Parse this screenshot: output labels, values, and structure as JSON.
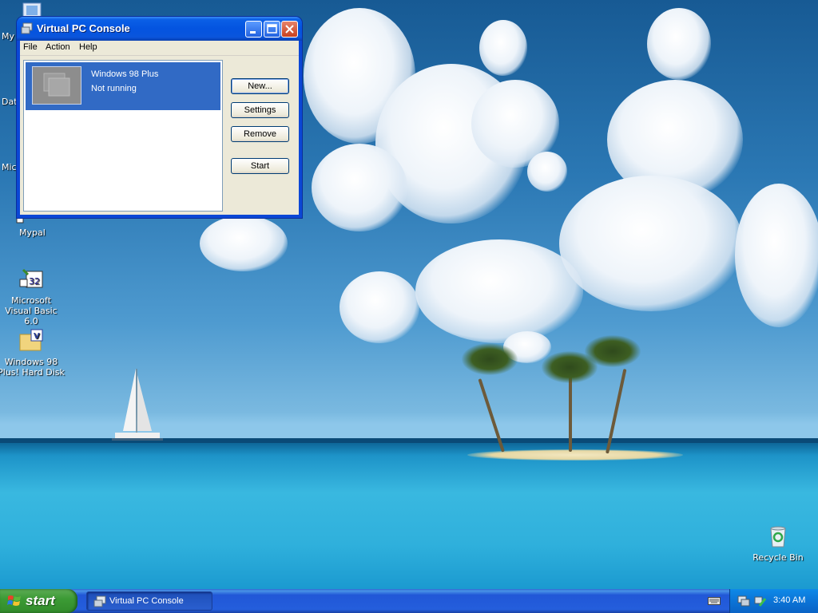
{
  "desktop": {
    "icons": [
      {
        "label": "My",
        "icon": "my-documents-icon"
      },
      {
        "label": "Dat",
        "icon": "database-icon"
      },
      {
        "label": "Micro",
        "icon": "microsoft-icon"
      },
      {
        "label": "Mypal",
        "icon": "mypal-icon"
      },
      {
        "label": "Microsoft Visual Basic 6.0",
        "icon": "visual-basic-icon"
      },
      {
        "label": "Windows 98 Plus! Hard Disk",
        "icon": "hard-disk-icon"
      },
      {
        "label": "Recycle Bin",
        "icon": "recycle-bin-icon"
      }
    ]
  },
  "window": {
    "title": "Virtual PC Console",
    "controls": {
      "minimize": "minimize-icon",
      "maximize": "maximize-icon",
      "close": "close-icon"
    },
    "menu": [
      "File",
      "Action",
      "Help"
    ],
    "vm_list": [
      {
        "name": "Windows 98 Plus",
        "status": "Not running",
        "selected": true
      }
    ],
    "buttons": {
      "new": "New...",
      "settings": "Settings",
      "remove": "Remove",
      "start": "Start"
    }
  },
  "taskbar": {
    "start_label": "start",
    "tasks": [
      {
        "label": "Virtual PC Console",
        "icon": "virtual-pc-icon"
      }
    ],
    "tray": {
      "clock": "3:40 AM",
      "icons": [
        "network-icon",
        "virtual-pc-tray-icon"
      ]
    },
    "language_icon": "keyboard-icon"
  },
  "colors": {
    "title_bar": "#0454e0",
    "selection": "#316ac5",
    "taskbar": "#245edc",
    "start_button": "#3c9b35",
    "window_face": "#ece9d8"
  }
}
